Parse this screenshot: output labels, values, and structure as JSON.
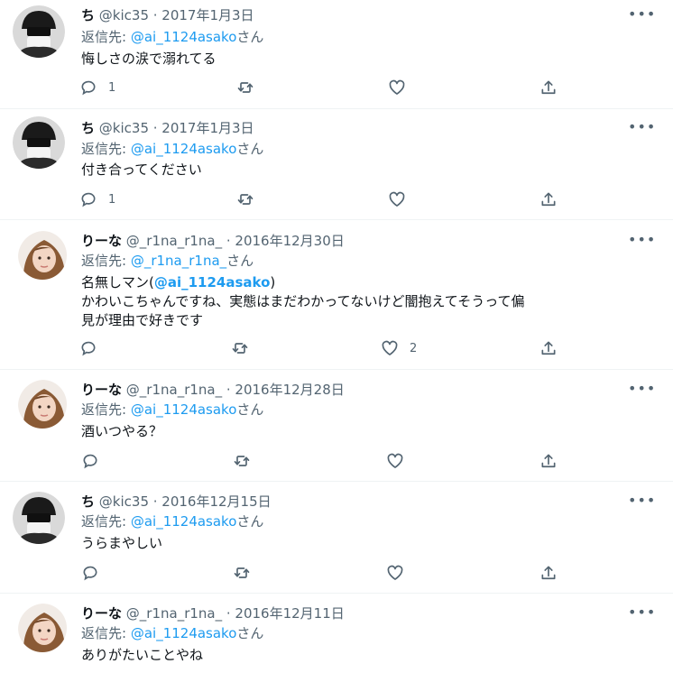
{
  "tweets": [
    {
      "avatar": "masked-avatar",
      "name": "ち",
      "handle": "@kic35 · 2017年1月3日",
      "reply_prefix": "返信先: ",
      "reply_user": "@ai_1124asako",
      "reply_suffix": "さん",
      "text_lines": [
        "悔しさの涙で溺れてる"
      ],
      "reply_count": "1",
      "retweet_count": "",
      "like_count": ""
    },
    {
      "avatar": "masked-avatar",
      "name": "ち",
      "handle": "@kic35 · 2017年1月3日",
      "reply_prefix": "返信先: ",
      "reply_user": "@ai_1124asako",
      "reply_suffix": "さん",
      "text_lines": [
        "付き合ってください"
      ],
      "reply_count": "1",
      "retweet_count": "",
      "like_count": ""
    },
    {
      "avatar": "girl-avatar",
      "name": "りーな",
      "handle": "@_r1na_r1na_ · 2016年12月30日",
      "reply_prefix": "返信先: ",
      "reply_user": "@_r1na_r1na_",
      "reply_suffix": "さん",
      "text_prefix": "名無しマン(",
      "text_mention": "@ai_1124asako",
      "text_suffix": ")",
      "text_lines": [
        "かわいこちゃんですね、実態はまだわかってないけど闇抱えてそうって偏",
        "見が理由で好きです"
      ],
      "reply_count": "",
      "retweet_count": "",
      "like_count": "2"
    },
    {
      "avatar": "girl-avatar",
      "name": "りーな",
      "handle": "@_r1na_r1na_ · 2016年12月28日",
      "reply_prefix": "返信先: ",
      "reply_user": "@ai_1124asako",
      "reply_suffix": "さん",
      "text_lines": [
        "酒いつやる？"
      ],
      "reply_count": "",
      "retweet_count": "",
      "like_count": ""
    },
    {
      "avatar": "masked-avatar",
      "name": "ち",
      "handle": "@kic35 · 2016年12月15日",
      "reply_prefix": "返信先: ",
      "reply_user": "@ai_1124asako",
      "reply_suffix": "さん",
      "text_lines": [
        "うらまやしい"
      ],
      "reply_count": "",
      "retweet_count": "",
      "like_count": ""
    },
    {
      "avatar": "girl-avatar",
      "name": "りーな",
      "handle": "@_r1na_r1na_ · 2016年12月11日",
      "reply_prefix": "返信先: ",
      "reply_user": "@ai_1124asako",
      "reply_suffix": "さん",
      "text_lines": [
        "ありがたいことやね"
      ],
      "reply_count": "",
      "retweet_count": "",
      "like_count": ""
    }
  ],
  "more_icon": "more-dots-icon",
  "colors": {
    "link": "#1d9bf0",
    "secondary": "#536471",
    "text": "#0f1419",
    "divider": "#eff3f4"
  }
}
